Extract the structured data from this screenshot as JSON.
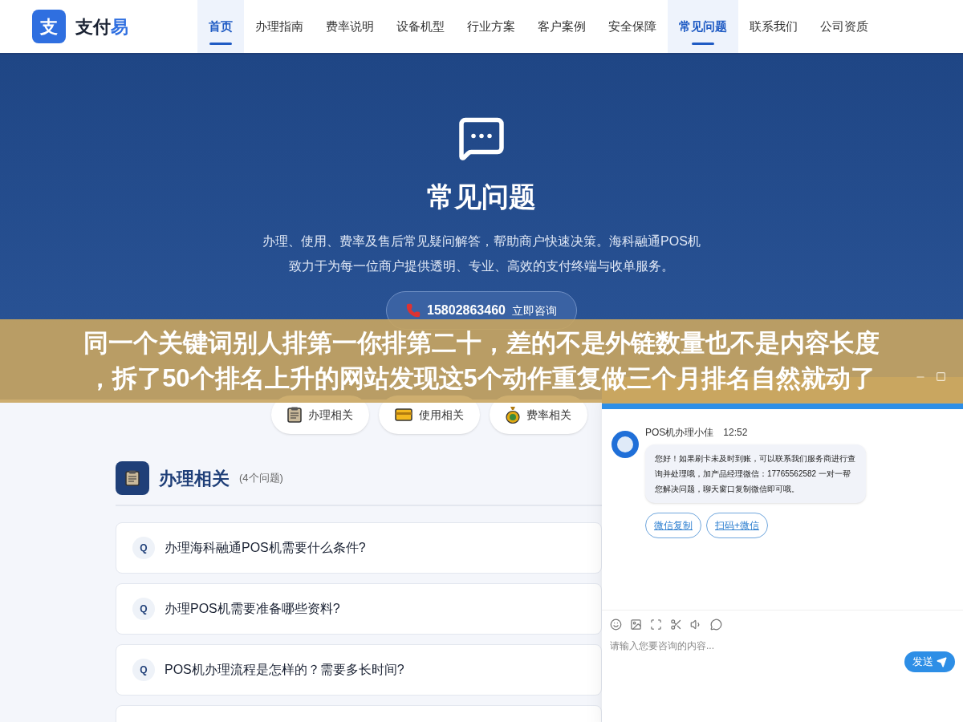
{
  "logo": {
    "mark": "支",
    "name": "支付",
    "accent": "易"
  },
  "nav": [
    {
      "label": "首页",
      "selected": true
    },
    {
      "label": "办理指南",
      "selected": false
    },
    {
      "label": "费率说明",
      "selected": false
    },
    {
      "label": "设备机型",
      "selected": false
    },
    {
      "label": "行业方案",
      "selected": false
    },
    {
      "label": "客户案例",
      "selected": false
    },
    {
      "label": "安全保障",
      "selected": false
    },
    {
      "label": "常见问题",
      "selected": true
    },
    {
      "label": "联系我们",
      "selected": false
    },
    {
      "label": "公司资质",
      "selected": false
    }
  ],
  "hero": {
    "title": "常见问题",
    "description": "办理、使用、费率及售后常见疑问解答，帮助商户快速决策。海科融通POS机致力于为每一位商户提供透明、专业、高效的支付终端与收单服务。",
    "phone": "15802863460",
    "phone_action": "立即咨询"
  },
  "categories": [
    {
      "kind": "clipboard",
      "label": "办理相关"
    },
    {
      "kind": "card",
      "label": "使用相关"
    },
    {
      "kind": "moneybag",
      "label": "费率相关"
    }
  ],
  "section": {
    "title": "办理相关",
    "count": "(4个问题)"
  },
  "questions": [
    {
      "mark": "Q",
      "text": "办理海科融通POS机需要什么条件?"
    },
    {
      "mark": "Q",
      "text": "办理POS机需要准备哪些资料?"
    },
    {
      "mark": "Q",
      "text": "POS机办理流程是怎样的？需要多长时间?"
    }
  ],
  "chat": {
    "agent": "POS机办理小佳",
    "time": "12:52",
    "message": "您好！如果刷卡未及时到账，可以联系我们服务商进行查询并处理哦，加产品经理微信：17765562582 一对一帮您解决问题，聊天窗口复制微信即可哦。",
    "actions": [
      "微信复制",
      "扫码+微信"
    ],
    "placeholder": "请输入您要咨询的内容...",
    "send": "发送"
  },
  "banner": {
    "lines": [
      "同一个关键词别人排第一你排第二十，差的不是外链数量也不是内容长度",
      "，拆了50个排名上升的网站发现这5个动作重复做三个月排名自然就动了"
    ]
  }
}
